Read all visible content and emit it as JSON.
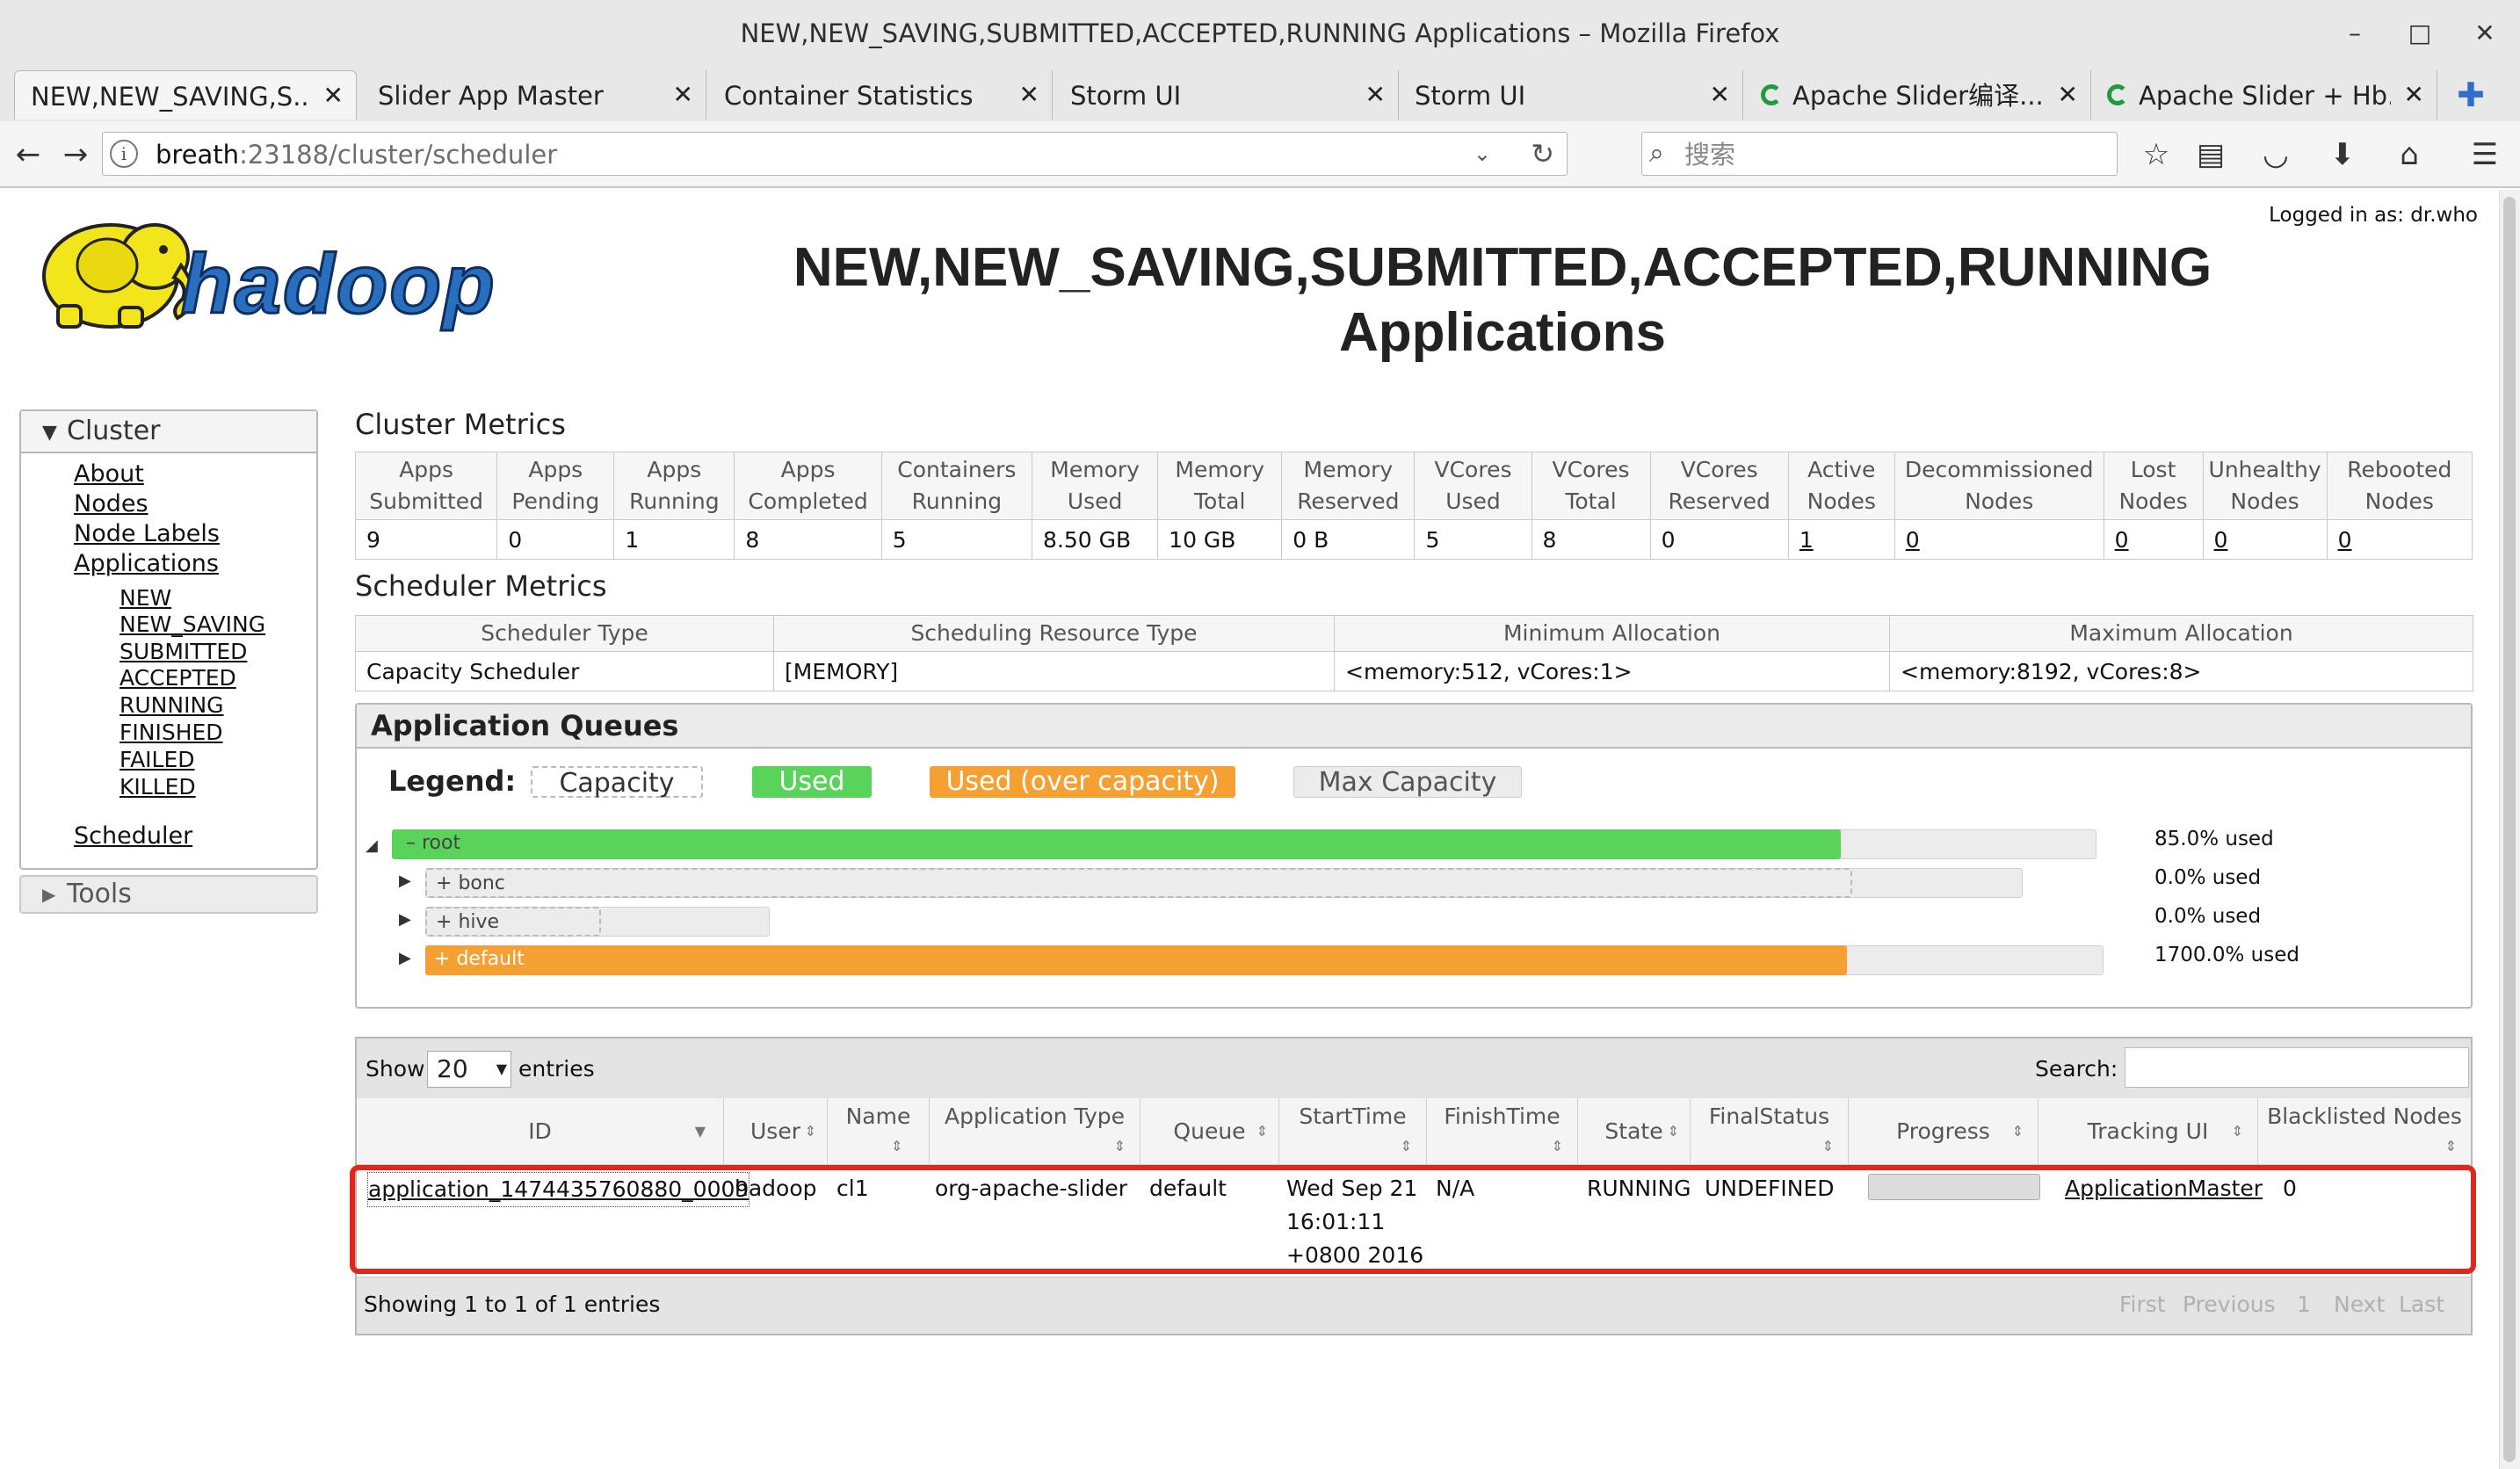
{
  "window": {
    "title": "NEW,NEW_SAVING,SUBMITTED,ACCEPTED,RUNNING Applications – Mozilla Firefox",
    "minimize": "–",
    "maximize": "□",
    "close": "✕"
  },
  "tabs": [
    {
      "label": "NEW,NEW_SAVING,S...",
      "close": "✕"
    },
    {
      "label": "Slider App Master",
      "close": "✕"
    },
    {
      "label": "Container Statistics",
      "close": "✕"
    },
    {
      "label": "Storm UI",
      "close": "✕"
    },
    {
      "label": "Storm UI",
      "close": "✕"
    },
    {
      "label": "Apache Slider编译...",
      "close": "✕"
    },
    {
      "label": "Apache Slider + Hb...",
      "close": "✕"
    }
  ],
  "new_tab": "✚",
  "nav": {
    "back": "←",
    "forward": "→",
    "url_host": "breath",
    "url_rest": ":23188/cluster/scheduler",
    "url_dropdown": "⌄",
    "reload": "↻",
    "search_placeholder": "搜索",
    "toolbar_icons": [
      "☆",
      "▤",
      "◡",
      "⬇",
      "⌂",
      "☰"
    ]
  },
  "header": {
    "logged_in": "Logged in as: dr.who",
    "logo_text": "hadoop",
    "title_line1": "NEW,NEW_SAVING,SUBMITTED,ACCEPTED,RUNNING",
    "title_line2": "Applications"
  },
  "sidebar": {
    "cluster_label": "Cluster",
    "links": [
      "About",
      "Nodes",
      "Node Labels",
      "Applications"
    ],
    "app_states": [
      "NEW",
      "NEW_SAVING",
      "SUBMITTED",
      "ACCEPTED",
      "RUNNING",
      "FINISHED",
      "FAILED",
      "KILLED"
    ],
    "scheduler": "Scheduler",
    "tools_label": "Tools"
  },
  "cluster_metrics": {
    "heading": "Cluster Metrics",
    "columns": [
      [
        "Apps",
        "Submitted"
      ],
      [
        "Apps",
        "Pending"
      ],
      [
        "Apps",
        "Running"
      ],
      [
        "Apps",
        "Completed"
      ],
      [
        "Containers",
        "Running"
      ],
      [
        "Memory",
        "Used"
      ],
      [
        "Memory",
        "Total"
      ],
      [
        "Memory",
        "Reserved"
      ],
      [
        "VCores",
        "Used"
      ],
      [
        "VCores",
        "Total"
      ],
      [
        "VCores",
        "Reserved"
      ],
      [
        "Active",
        "Nodes"
      ],
      [
        "Decommissioned",
        "Nodes"
      ],
      [
        "Lost",
        "Nodes"
      ],
      [
        "Unhealthy",
        "Nodes"
      ],
      [
        "Rebooted",
        "Nodes"
      ]
    ],
    "values": [
      "9",
      "0",
      "1",
      "8",
      "5",
      "8.50 GB",
      "10 GB",
      "0 B",
      "5",
      "8",
      "0",
      "1",
      "0",
      "0",
      "0",
      "0"
    ]
  },
  "scheduler_metrics": {
    "heading": "Scheduler Metrics",
    "columns": [
      "Scheduler Type",
      "Scheduling Resource Type",
      "Minimum Allocation",
      "Maximum Allocation"
    ],
    "values": [
      "Capacity Scheduler",
      "[MEMORY]",
      "<memory:512, vCores:1>",
      "<memory:8192, vCores:8>"
    ]
  },
  "queues": {
    "heading": "Application Queues",
    "legend_label": "Legend:",
    "legend": [
      "Capacity",
      "Used",
      "Used (over capacity)",
      "Max Capacity"
    ],
    "colors": {
      "used": "#5ad35a",
      "over": "#f5a033",
      "max": "#ececec"
    },
    "items": [
      {
        "name": "root",
        "sign": "–",
        "used_pct": "85.0% used",
        "used": 0.85
      },
      {
        "name": "bonc",
        "sign": "+",
        "used_pct": "0.0% used",
        "used": 0.0
      },
      {
        "name": "hive",
        "sign": "+",
        "used_pct": "0.0% used",
        "used": 0.0
      },
      {
        "name": "default",
        "sign": "+",
        "used_pct": "1700.0% used",
        "used": 17.0
      }
    ]
  },
  "apps_table": {
    "show_label": "Show",
    "entries_value": "20",
    "entries_label": "entries",
    "search_label": "Search:",
    "columns": [
      "ID",
      "User",
      "Name",
      "Application Type",
      "Queue",
      "StartTime",
      "FinishTime",
      "State",
      "FinalStatus",
      "Progress",
      "Tracking UI",
      "Blacklisted Nodes"
    ],
    "row": {
      "id": "application_1474435760880_0009",
      "user": "hadoop",
      "name": "cl1",
      "type": "org-apache-slider",
      "queue": "default",
      "start_line1": "Wed Sep 21",
      "start_line2": "16:01:11",
      "start_line3": "+0800 2016",
      "finish": "N/A",
      "state": "RUNNING",
      "final_status": "UNDEFINED",
      "tracking": "ApplicationMaster",
      "blacklisted": "0"
    },
    "footer_info": "Showing 1 to 1 of 1 entries",
    "pager": [
      "First",
      "Previous",
      "1",
      "Next",
      "Last"
    ]
  }
}
